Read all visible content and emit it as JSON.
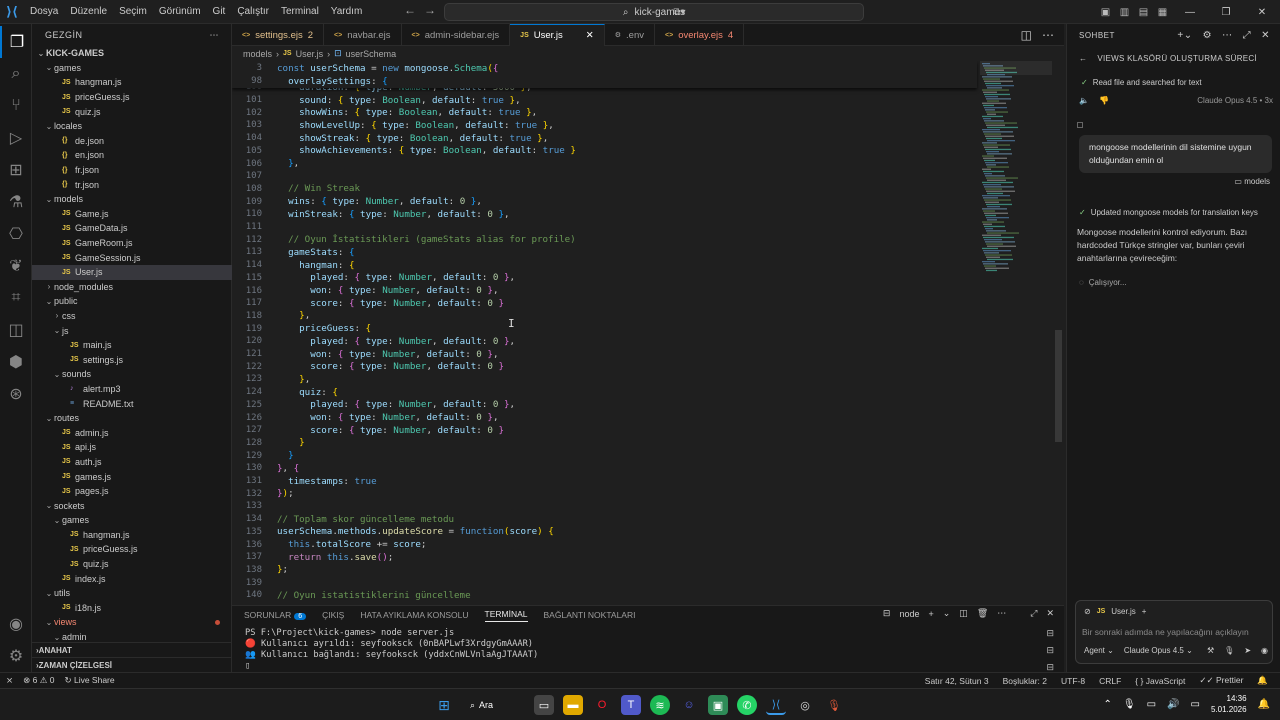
{
  "menu": [
    "Dosya",
    "Düzenle",
    "Seçim",
    "Görünüm",
    "Git",
    "Çalıştır",
    "Terminal",
    "Yardım"
  ],
  "search_text": "kick-games",
  "sidebar": {
    "title": "GEZGİN",
    "root": "KICK-GAMES",
    "outline": "ANAHAT",
    "timeline": "ZAMAN ÇİZELGESİ",
    "tree": [
      {
        "label": "games",
        "type": "folder-open",
        "depth": 1
      },
      {
        "label": "hangman.js",
        "type": "js",
        "depth": 2
      },
      {
        "label": "priceGuess.js",
        "type": "js",
        "depth": 2
      },
      {
        "label": "quiz.js",
        "type": "js",
        "depth": 2
      },
      {
        "label": "locales",
        "type": "folder-open",
        "depth": 1
      },
      {
        "label": "de.json",
        "type": "json",
        "depth": 2
      },
      {
        "label": "en.json",
        "type": "json",
        "depth": 2
      },
      {
        "label": "fr.json",
        "type": "json",
        "depth": 2
      },
      {
        "label": "tr.json",
        "type": "json",
        "depth": 2
      },
      {
        "label": "models",
        "type": "folder-open",
        "depth": 1
      },
      {
        "label": "Game.js",
        "type": "js",
        "depth": 2
      },
      {
        "label": "GameData.js",
        "type": "js",
        "depth": 2
      },
      {
        "label": "GameRoom.js",
        "type": "js",
        "depth": 2
      },
      {
        "label": "GameSession.js",
        "type": "js",
        "depth": 2
      },
      {
        "label": "User.js",
        "type": "js",
        "depth": 2,
        "selected": true
      },
      {
        "label": "node_modules",
        "type": "folder",
        "depth": 1
      },
      {
        "label": "public",
        "type": "folder-open",
        "depth": 1
      },
      {
        "label": "css",
        "type": "folder",
        "depth": 2
      },
      {
        "label": "js",
        "type": "folder-open",
        "depth": 2
      },
      {
        "label": "main.js",
        "type": "js",
        "depth": 3
      },
      {
        "label": "settings.js",
        "type": "js",
        "depth": 3
      },
      {
        "label": "sounds",
        "type": "folder-open",
        "depth": 2
      },
      {
        "label": "alert.mp3",
        "type": "mp3",
        "depth": 3
      },
      {
        "label": "README.txt",
        "type": "txt",
        "depth": 3
      },
      {
        "label": "routes",
        "type": "folder-open",
        "depth": 1
      },
      {
        "label": "admin.js",
        "type": "js",
        "depth": 2
      },
      {
        "label": "api.js",
        "type": "js",
        "depth": 2
      },
      {
        "label": "auth.js",
        "type": "js",
        "depth": 2
      },
      {
        "label": "games.js",
        "type": "js",
        "depth": 2
      },
      {
        "label": "pages.js",
        "type": "js",
        "depth": 2
      },
      {
        "label": "sockets",
        "type": "folder-open",
        "depth": 1
      },
      {
        "label": "games",
        "type": "folder-open",
        "depth": 2
      },
      {
        "label": "hangman.js",
        "type": "js",
        "depth": 3
      },
      {
        "label": "priceGuess.js",
        "type": "js",
        "depth": 3
      },
      {
        "label": "quiz.js",
        "type": "js",
        "depth": 3
      },
      {
        "label": "index.js",
        "type": "js",
        "depth": 2
      },
      {
        "label": "utils",
        "type": "folder-open",
        "depth": 1
      },
      {
        "label": "i18n.js",
        "type": "js",
        "depth": 2
      },
      {
        "label": "views",
        "type": "folder-open",
        "depth": 1,
        "modified": true
      },
      {
        "label": "admin",
        "type": "folder-open",
        "depth": 2
      }
    ]
  },
  "tabs": [
    {
      "label": "settings.ejs",
      "badge": "2",
      "icon": "ejs",
      "state": "modified"
    },
    {
      "label": "navbar.ejs",
      "badge": "",
      "icon": "ejs",
      "state": ""
    },
    {
      "label": "admin-sidebar.ejs",
      "badge": "",
      "icon": "ejs",
      "state": ""
    },
    {
      "label": "User.js",
      "badge": "",
      "icon": "JS",
      "state": "active"
    },
    {
      "label": ".env",
      "badge": "",
      "icon": "gear",
      "state": ""
    },
    {
      "label": "overlay.ejs",
      "badge": "4",
      "icon": "ejs",
      "state": "error"
    }
  ],
  "breadcrumb": [
    "models",
    "User.js",
    "userSchema"
  ],
  "editor": {
    "sticky": [
      {
        "n": "3",
        "html": "<span class='kw'>const</span> <span class='prop'>userSchema</span> = <span class='kw'>new</span> <span class='prop'>mongoose</span>.<span class='type'>Schema</span><span class='b1'>(</span><span class='b2'>{</span>"
      },
      {
        "n": "98",
        "html": "  <span class='prop'>overlaySettings</span>: <span class='b3'>{</span>"
      }
    ],
    "lines": [
      {
        "n": "100",
        "html": "    <span class='prop'>duration</span>: <span class='b1'>{</span> <span class='prop'>type</span>: <span class='type'>Number</span>, <span class='prop'>default</span>: <span class='num'>5000</span> <span class='b1'>}</span>,"
      },
      {
        "n": "101",
        "html": "    <span class='prop'>sound</span>: <span class='b1'>{</span> <span class='prop'>type</span>: <span class='type'>Boolean</span>, <span class='prop'>default</span>: <span class='kw'>true</span> <span class='b1'>}</span>,"
      },
      {
        "n": "102",
        "html": "    <span class='prop'>showWins</span>: <span class='b1'>{</span> <span class='prop'>type</span>: <span class='type'>Boolean</span>, <span class='prop'>default</span>: <span class='kw'>true</span> <span class='b1'>}</span>,"
      },
      {
        "n": "103",
        "html": "    <span class='prop'>showLevelUp</span>: <span class='b1'>{</span> <span class='prop'>type</span>: <span class='type'>Boolean</span>, <span class='prop'>default</span>: <span class='kw'>true</span> <span class='b1'>}</span>,"
      },
      {
        "n": "104",
        "html": "    <span class='prop'>showStreak</span>: <span class='b1'>{</span> <span class='prop'>type</span>: <span class='type'>Boolean</span>, <span class='prop'>default</span>: <span class='kw'>true</span> <span class='b1'>}</span>,"
      },
      {
        "n": "105",
        "html": "    <span class='prop'>showAchievements</span>: <span class='b1'>{</span> <span class='prop'>type</span>: <span class='type'>Boolean</span>, <span class='prop'>default</span>: <span class='kw'>true</span> <span class='b1'>}</span>"
      },
      {
        "n": "106",
        "html": "  <span class='b3'>}</span>,"
      },
      {
        "n": "107",
        "html": ""
      },
      {
        "n": "108",
        "html": "  <span class='cmt'>// Win Streak</span>"
      },
      {
        "n": "109",
        "html": "  <span class='prop'>wins</span>: <span class='b3'>{</span> <span class='prop'>type</span>: <span class='type'>Number</span>, <span class='prop'>default</span>: <span class='num'>0</span> <span class='b3'>}</span>,"
      },
      {
        "n": "110",
        "html": "  <span class='prop'>winStreak</span>: <span class='b3'>{</span> <span class='prop'>type</span>: <span class='type'>Number</span>, <span class='prop'>default</span>: <span class='num'>0</span> <span class='b3'>}</span>,"
      },
      {
        "n": "111",
        "html": ""
      },
      {
        "n": "112",
        "html": "  <span class='cmt'>// Oyun İstatistikleri (gameStats alias for profile)</span>"
      },
      {
        "n": "113",
        "html": "  <span class='prop'>gameStats</span>: <span class='b3'>{</span>"
      },
      {
        "n": "114",
        "html": "    <span class='prop'>hangman</span>: <span class='b1'>{</span>"
      },
      {
        "n": "115",
        "html": "      <span class='prop'>played</span>: <span class='b2'>{</span> <span class='prop'>type</span>: <span class='type'>Number</span>, <span class='prop'>default</span>: <span class='num'>0</span> <span class='b2'>}</span>,"
      },
      {
        "n": "116",
        "html": "      <span class='prop'>won</span>: <span class='b2'>{</span> <span class='prop'>type</span>: <span class='type'>Number</span>, <span class='prop'>default</span>: <span class='num'>0</span> <span class='b2'>}</span>,"
      },
      {
        "n": "117",
        "html": "      <span class='prop'>score</span>: <span class='b2'>{</span> <span class='prop'>type</span>: <span class='type'>Number</span>, <span class='prop'>default</span>: <span class='num'>0</span> <span class='b2'>}</span>"
      },
      {
        "n": "118",
        "html": "    <span class='b1'>}</span>,"
      },
      {
        "n": "119",
        "html": "    <span class='prop'>priceGuess</span>: <span class='b1'>{</span>"
      },
      {
        "n": "120",
        "html": "      <span class='prop'>played</span>: <span class='b2'>{</span> <span class='prop'>type</span>: <span class='type'>Number</span>, <span class='prop'>default</span>: <span class='num'>0</span> <span class='b2'>}</span>,"
      },
      {
        "n": "121",
        "html": "      <span class='prop'>won</span>: <span class='b2'>{</span> <span class='prop'>type</span>: <span class='type'>Number</span>, <span class='prop'>default</span>: <span class='num'>0</span> <span class='b2'>}</span>,"
      },
      {
        "n": "122",
        "html": "      <span class='prop'>score</span>: <span class='b2'>{</span> <span class='prop'>type</span>: <span class='type'>Number</span>, <span class='prop'>default</span>: <span class='num'>0</span> <span class='b2'>}</span>"
      },
      {
        "n": "123",
        "html": "    <span class='b1'>}</span>,"
      },
      {
        "n": "124",
        "html": "    <span class='prop'>quiz</span>: <span class='b1'>{</span>"
      },
      {
        "n": "125",
        "html": "      <span class='prop'>played</span>: <span class='b2'>{</span> <span class='prop'>type</span>: <span class='type'>Number</span>, <span class='prop'>default</span>: <span class='num'>0</span> <span class='b2'>}</span>,"
      },
      {
        "n": "126",
        "html": "      <span class='prop'>won</span>: <span class='b2'>{</span> <span class='prop'>type</span>: <span class='type'>Number</span>, <span class='prop'>default</span>: <span class='num'>0</span> <span class='b2'>}</span>,"
      },
      {
        "n": "127",
        "html": "      <span class='prop'>score</span>: <span class='b2'>{</span> <span class='prop'>type</span>: <span class='type'>Number</span>, <span class='prop'>default</span>: <span class='num'>0</span> <span class='b2'>}</span>"
      },
      {
        "n": "128",
        "html": "    <span class='b1'>}</span>"
      },
      {
        "n": "129",
        "html": "  <span class='b3'>}</span>"
      },
      {
        "n": "130",
        "html": "<span class='b2'>}</span>, <span class='b2'>{</span>"
      },
      {
        "n": "131",
        "html": "  <span class='prop'>timestamps</span>: <span class='kw'>true</span>"
      },
      {
        "n": "132",
        "html": "<span class='b2'>}</span><span class='b1'>)</span>;"
      },
      {
        "n": "133",
        "html": ""
      },
      {
        "n": "134",
        "html": "<span class='cmt'>// Toplam skor güncelleme metodu</span>"
      },
      {
        "n": "135",
        "html": "<span class='prop'>userSchema</span>.<span class='prop'>methods</span>.<span class='fn'>updateScore</span> = <span class='kw'>function</span><span class='b1'>(</span><span class='prop'>score</span><span class='b1'>)</span> <span class='b1'>{</span>"
      },
      {
        "n": "136",
        "html": "  <span class='kw'>this</span>.<span class='prop'>totalScore</span> += <span class='prop'>score</span>;"
      },
      {
        "n": "137",
        "html": "  <span class='ctrl'>return</span> <span class='kw'>this</span>.<span class='fn'>save</span><span class='b2'>()</span>;"
      },
      {
        "n": "138",
        "html": "<span class='b1'>}</span>;"
      },
      {
        "n": "139",
        "html": ""
      },
      {
        "n": "140",
        "html": "<span class='cmt'>// Oyun istatistiklerini güncelleme</span>"
      }
    ]
  },
  "panel": {
    "tabs": [
      "SORUNLAR",
      "ÇIKIŞ",
      "HATA AYIKLAMA KONSOLU",
      "TERMİNAL",
      "BAĞLANTI NOKTALARI"
    ],
    "problems_count": "6",
    "active_tab": "TERMİNAL",
    "terminal_name": "node",
    "terminal_lines": [
      "PS F:\\Project\\kick-games> node server.js",
      "🔴 Kullanıcı ayrıldı: seyfooksck (0nBAPLwf3XrdgyGmAAAR)",
      "👥 Kullanıcı bağlandı: seyfooksck (yddxCnWLVnlaAgJTAAAT)"
    ]
  },
  "chat": {
    "title": "SOHBET",
    "session": "VIEWS KLASÖRÜ OLUŞTURMA SÜRECİ",
    "step1": "Read file and searched for text",
    "model_tag": "Claude Opus 4.5 • 3x",
    "user_msg": "mongoose modellerinin dil sistemine uygun olduğundan emin ol",
    "chip": "models",
    "step2": "Updated mongoose models for translation keys",
    "response": "Mongoose modellerini kontrol ediyorum. Bazı hardcoded Türkçe stringler var, bunları çeviri anahtarlarına çevireceğim:",
    "working": "Çalışıyor...",
    "context_file": "User.js",
    "placeholder": "Bir sonraki adımda ne yapılacağını açıklayın",
    "mode": "Agent",
    "model": "Claude Opus 4.5"
  },
  "status": {
    "errors": "6",
    "warnings": "0",
    "liveshare": "Live Share",
    "position": "Satır 42, Sütun 3",
    "spaces": "Boşluklar: 2",
    "encoding": "UTF-8",
    "eol": "CRLF",
    "language": "JavaScript",
    "prettier": "Prettier"
  },
  "taskbar": {
    "search": "Ara",
    "time": "14:36",
    "date": "5.01.2026"
  }
}
